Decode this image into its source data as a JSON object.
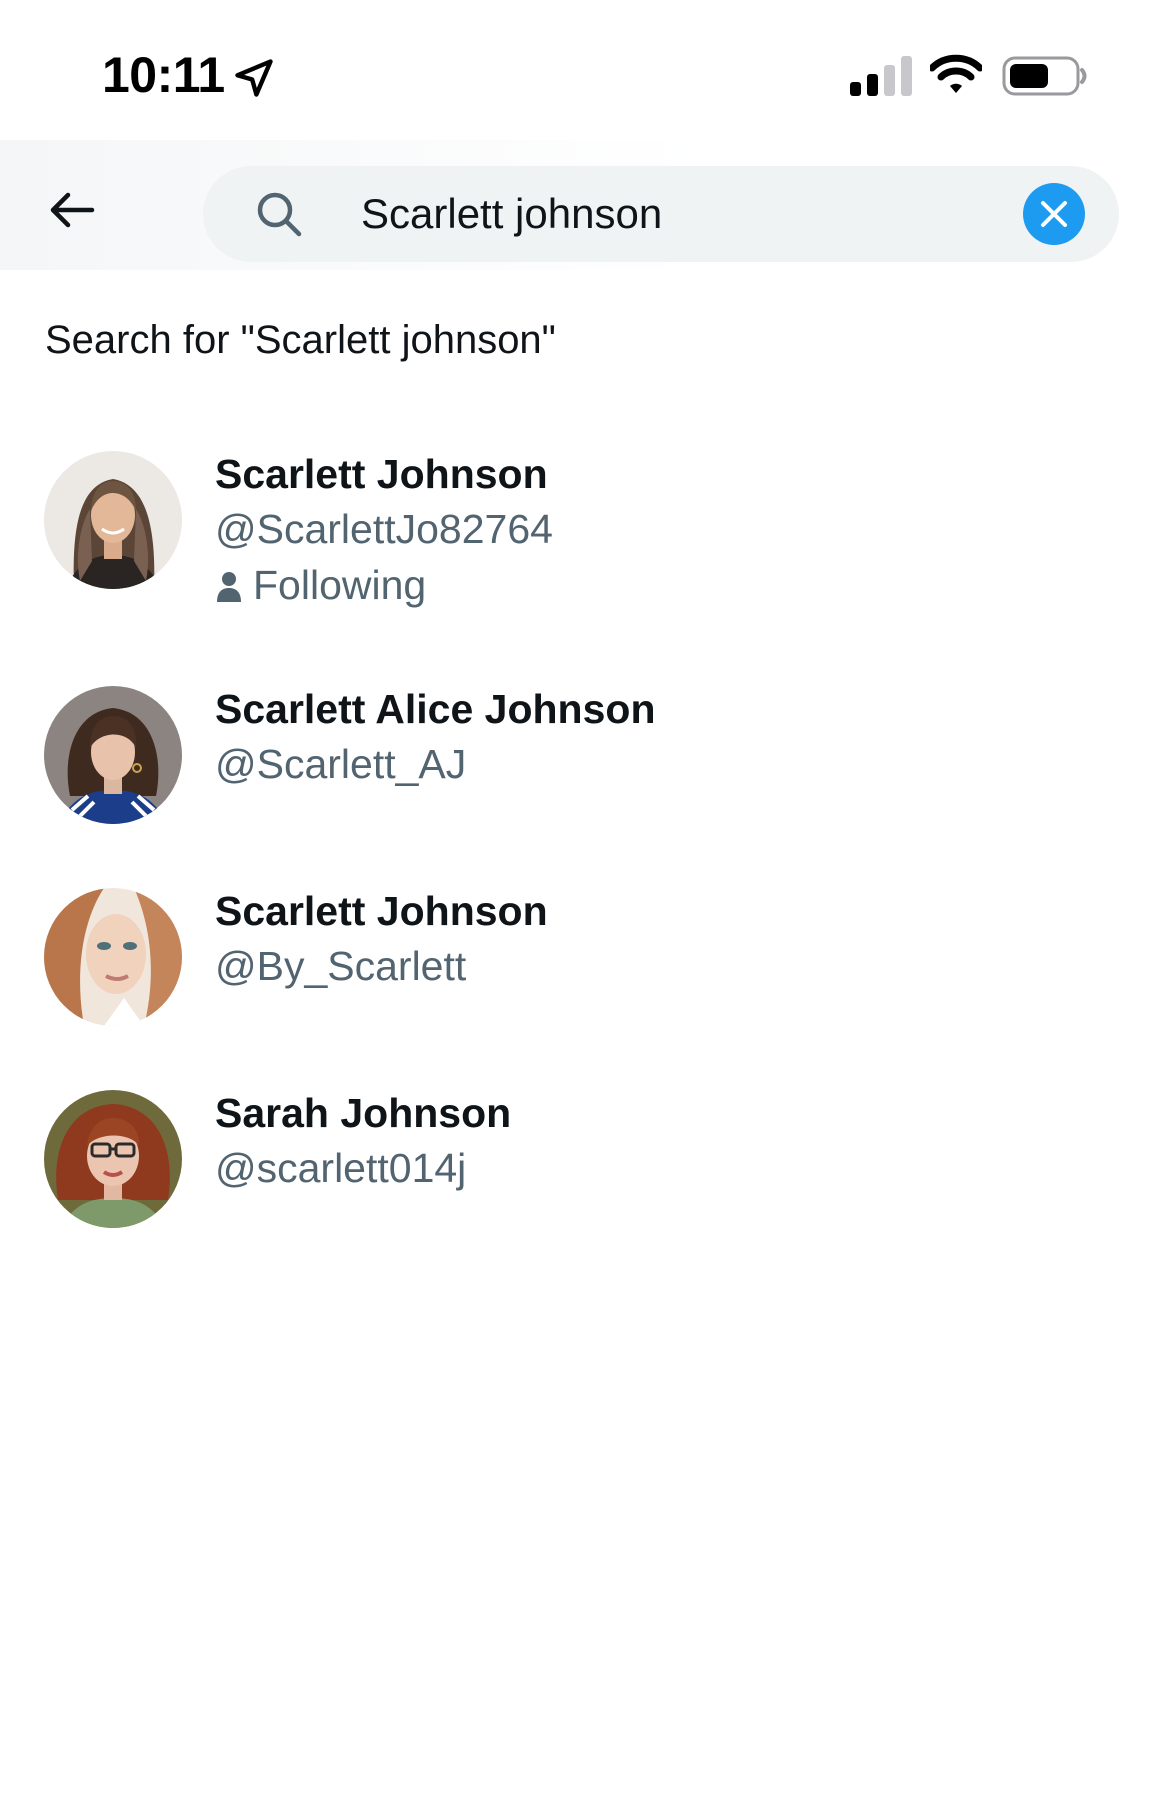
{
  "status_bar": {
    "time": "10:11",
    "icons": [
      "location-arrow-icon",
      "cellular-signal-icon",
      "wifi-icon",
      "battery-icon"
    ]
  },
  "header": {
    "back_icon": "arrow-left-icon",
    "search": {
      "value": "Scarlett johnson",
      "placeholder": "Search",
      "icon": "search-icon",
      "clear_icon": "close-icon"
    }
  },
  "search_for_label": "Search for \"Scarlett johnson\"",
  "results": [
    {
      "name": "Scarlett Johnson",
      "handle": "@ScarlettJo82764",
      "following": "Following"
    },
    {
      "name": "Scarlett Alice Johnson",
      "handle": "@Scarlett_AJ"
    },
    {
      "name": "Scarlett Johnson",
      "handle": "@By_Scarlett"
    },
    {
      "name": "Sarah Johnson",
      "handle": "@scarlett014j"
    }
  ],
  "colors": {
    "accent": "#1d9bf0",
    "text_primary": "#0f1419",
    "text_secondary": "#536471",
    "search_bg": "#eff3f4"
  }
}
